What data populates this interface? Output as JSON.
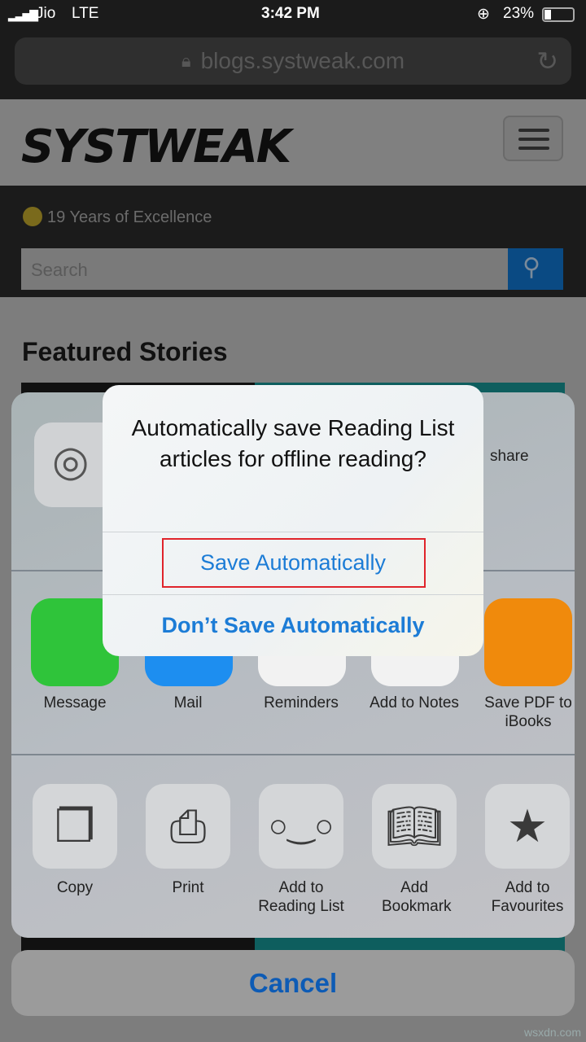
{
  "status_bar": {
    "carrier": "Jio",
    "network": "LTE",
    "time": "3:42 PM",
    "battery": "23%",
    "battery_level": 0.23
  },
  "browser": {
    "url": "blogs.systweak.com"
  },
  "site": {
    "logo": "SYSTWEAK",
    "tagline": "19 Years of Excellence",
    "search_placeholder": "Search",
    "section_title": "Featured Stories"
  },
  "share_sheet": {
    "airdrop_hint": "share",
    "apps": [
      {
        "label": "Message",
        "icon": "message-icon",
        "color": "#2fc43a"
      },
      {
        "label": "Mail",
        "icon": "mail-icon",
        "color": "#1d8ef0"
      },
      {
        "label": "Reminders",
        "icon": "reminders-icon",
        "color": "#f2f2f2"
      },
      {
        "label": "Add to Notes",
        "icon": "notes-icon",
        "color": "#f2f2f2"
      },
      {
        "label": "Save PDF to iBooks",
        "icon": "ibooks-icon",
        "color": "#f08a0c"
      }
    ],
    "actions": [
      {
        "label": "Copy",
        "icon": "copy-icon"
      },
      {
        "label": "Print",
        "icon": "print-icon"
      },
      {
        "label": "Add to Reading List",
        "icon": "glasses-icon"
      },
      {
        "label": "Add Bookmark",
        "icon": "book-icon"
      },
      {
        "label": "Add to Favourites",
        "icon": "star-icon"
      }
    ],
    "cancel": "Cancel"
  },
  "dialog": {
    "title": "Automatically save Reading List articles for offline reading?",
    "save": "Save Automatically",
    "dont_save": "Don’t Save Automatically",
    "accent": "#1c7cd6",
    "highlight": "#e0242b"
  },
  "watermark": "wsxdn.com"
}
